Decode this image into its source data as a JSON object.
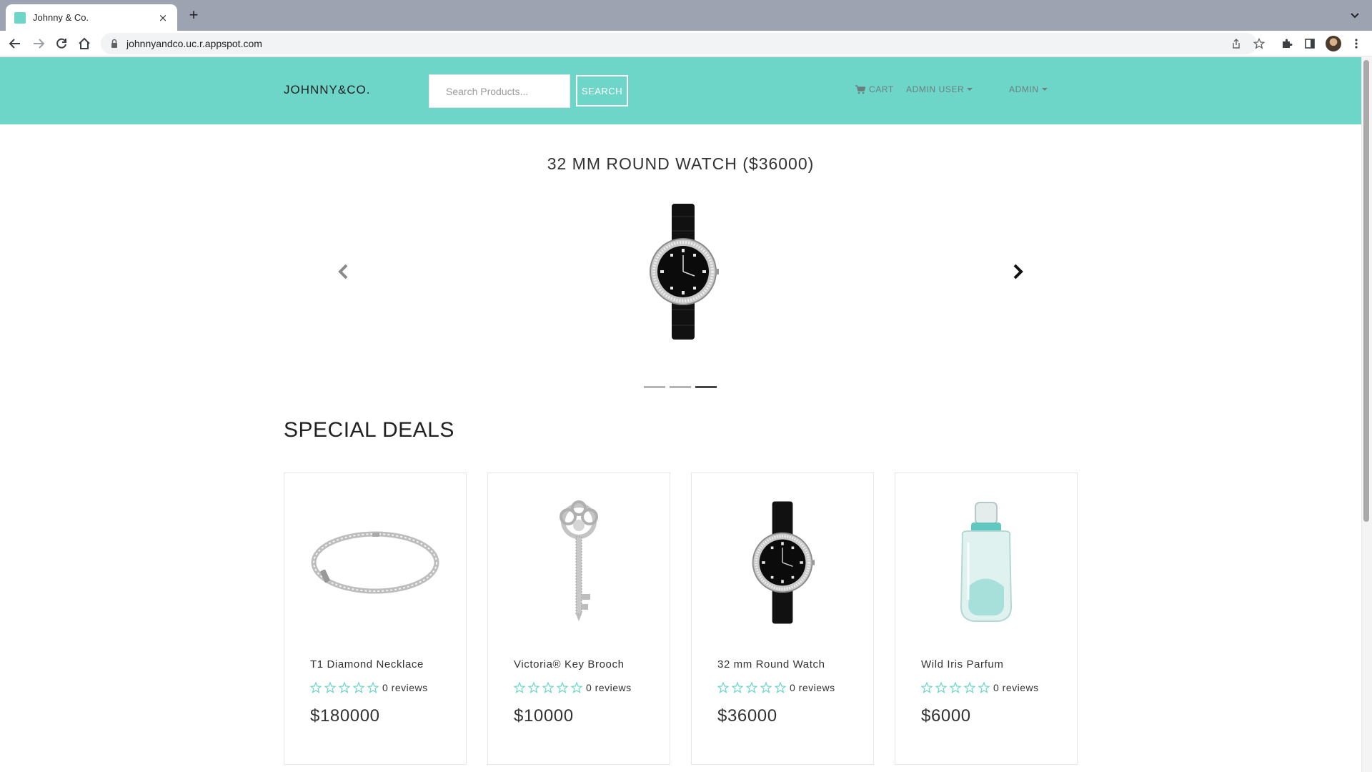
{
  "browser": {
    "tab_title": "Johnny & Co.",
    "tab_close": "×",
    "new_tab": "+",
    "url": "johnnyandco.uc.r.appspot.com"
  },
  "site": {
    "brand": "JOHNNY&CO.",
    "accent_color": "#6dd6c9",
    "search": {
      "placeholder": "Search Products...",
      "button_label": "SEARCH"
    },
    "nav": {
      "cart_label": "CART",
      "user_label": "ADMIN USER",
      "admin_label": "ADMIN"
    }
  },
  "carousel": {
    "title": "32 MM ROUND WATCH ($36000)",
    "image": "watch-image",
    "slide_count": 3,
    "active_slide": 3
  },
  "deals": {
    "title": "SPECIAL DEALS",
    "products": [
      {
        "name": "T1 Diamond Necklace",
        "image": "bangle-image",
        "reviews": "0 reviews",
        "price": "$180000",
        "rating": 0
      },
      {
        "name": "Victoria® Key Brooch",
        "image": "key-brooch-image",
        "reviews": "0 reviews",
        "price": "$10000",
        "rating": 0
      },
      {
        "name": "32 mm Round Watch",
        "image": "watch-image",
        "reviews": "0 reviews",
        "price": "$36000",
        "rating": 0
      },
      {
        "name": "Wild Iris Parfum",
        "image": "perfume-bottle-image",
        "reviews": "0 reviews",
        "price": "$6000",
        "rating": 0
      }
    ]
  }
}
